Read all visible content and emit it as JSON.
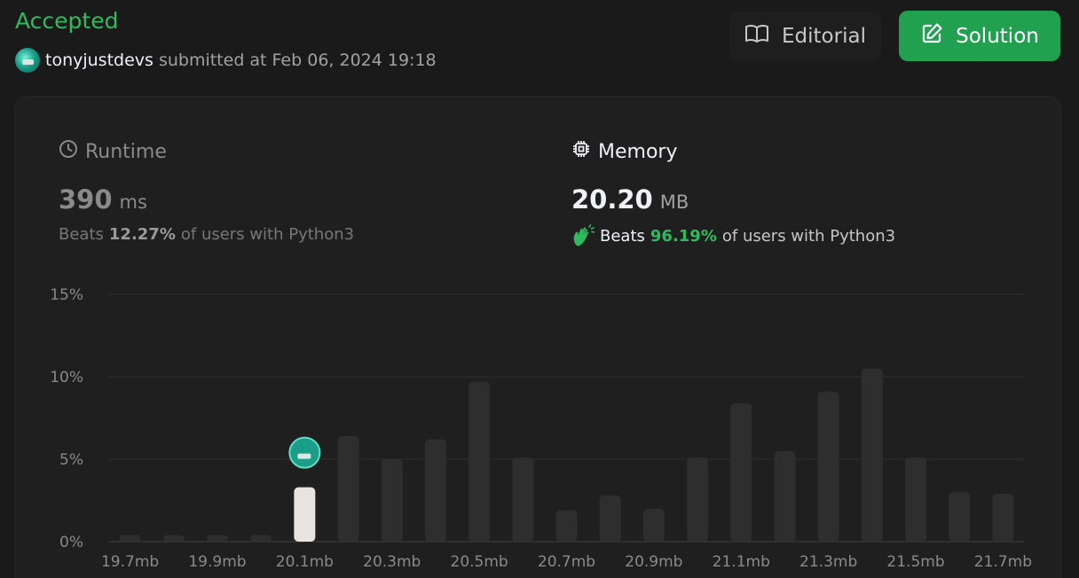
{
  "header": {
    "status": "Accepted",
    "username": "tonyjustdevs",
    "submitted_text": "submitted at Feb 06, 2024 19:18"
  },
  "buttons": {
    "editorial": "Editorial",
    "solution": "Solution"
  },
  "runtime": {
    "title": "Runtime",
    "value": "390",
    "unit": "ms",
    "beats_label": "Beats",
    "beats_pct": "12.27%",
    "beats_suffix": "of users with Python3"
  },
  "memory": {
    "title": "Memory",
    "value": "20.20",
    "unit": "MB",
    "beats_label": "Beats",
    "beats_pct": "96.19%",
    "beats_suffix": "of users with Python3"
  },
  "colors": {
    "accepted": "#2cbb5d",
    "solution_button": "#21a150",
    "bar": "#2e2e2e",
    "selected_bar": "#e8e3df"
  },
  "chart_data": {
    "type": "bar",
    "xlabel": "",
    "ylabel": "",
    "ylim": [
      0,
      15
    ],
    "y_ticks": [
      "0%",
      "5%",
      "10%",
      "15%"
    ],
    "x_tick_labels": [
      "19.7mb",
      "19.9mb",
      "20.1mb",
      "20.3mb",
      "20.5mb",
      "20.7mb",
      "20.9mb",
      "21.1mb",
      "21.3mb",
      "21.5mb",
      "21.7mb"
    ],
    "values": [
      0.4,
      0.4,
      0.4,
      0.4,
      3.3,
      6.4,
      5.0,
      6.2,
      9.7,
      5.1,
      1.9,
      2.8,
      2.0,
      5.1,
      8.4,
      5.5,
      9.1,
      10.5,
      5.1,
      3.0,
      2.9
    ],
    "selected_index": 4,
    "grid": true
  }
}
